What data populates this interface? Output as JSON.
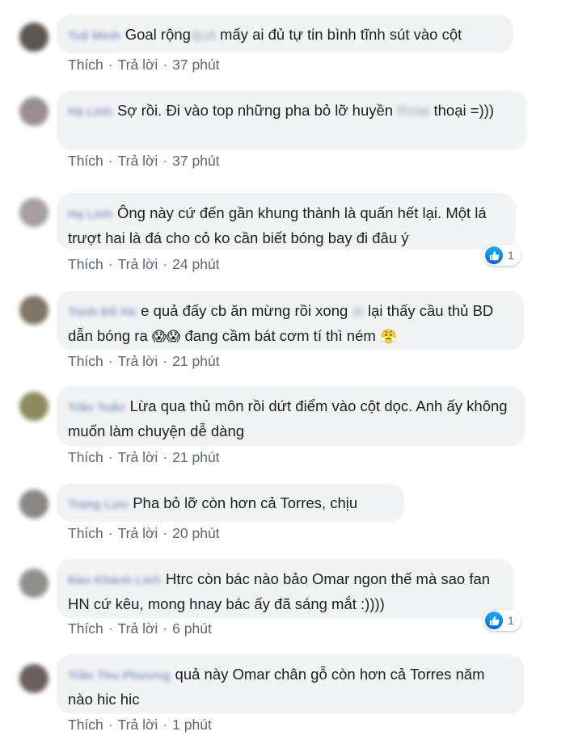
{
  "comments": [
    {
      "author": "Tuệ Minh",
      "text1": "Goal rộng",
      "blur1": "quá",
      "text2": " mấy ai đủ tự tin bình tĩnh sút vào cột",
      "time": "37 phút",
      "likes": null
    },
    {
      "author": "Hà Linh",
      "text1": "Sợ rồi. Đi vào top những pha bỏ lỡ huyền",
      "blur1": "thoại",
      "text2": " thoại =)))",
      "time": "37 phút",
      "likes": null
    },
    {
      "author": "Hạ Linh",
      "text": "Ông này cứ đến gần khung thành là quấn hết lại. Một lá trượt hai là đá cho cỏ ko cần biết bóng bay đi đâu ý",
      "time": "24 phút",
      "likes": "1"
    },
    {
      "author": "Trịnh Đỗ Hà",
      "text1": "e quả đấy cb ăn mừng rồi xong",
      "blur1": "ai",
      "text2": " lại thấy cầu thủ BD dẫn bóng ra",
      "emoji1": "😱😱",
      "text3": " đang cầm bát cơm tí thì ném ",
      "emoji2": "😤",
      "time": "21 phút",
      "likes": null
    },
    {
      "author": "Trần Tuấn",
      "text": "Lừa qua thủ môn rồi dứt điểm vào cột dọc. Anh ấy không muốn làm chuyện dễ dàng",
      "time": "21 phút",
      "likes": null
    },
    {
      "author": "Trang Lưu",
      "text": "Pha bỏ lỡ còn hơn cả Torres, chịu",
      "time": "20 phút",
      "likes": null
    },
    {
      "author": "Đào Khánh Linh",
      "text": "Htrc còn bác nào bảo Omar ngon thế mà sao fan HN cứ kêu, mong hnay bác ấy đã sáng mắt :))))",
      "time": "6 phút",
      "likes": "1"
    },
    {
      "author": "Trần Thu Phương",
      "text": "quả này Omar chân gỗ còn hơn cả Torres năm nào hic hic",
      "time": "1 phút",
      "likes": null
    }
  ],
  "actions": {
    "like": "Thích",
    "reply": "Trả lời",
    "sep": "·"
  },
  "icons": {
    "like": "like-thumb-icon"
  },
  "colors": {
    "bubble": "#f2f3f5",
    "action_text": "#5e6673",
    "like_blue": "#1877f2"
  }
}
